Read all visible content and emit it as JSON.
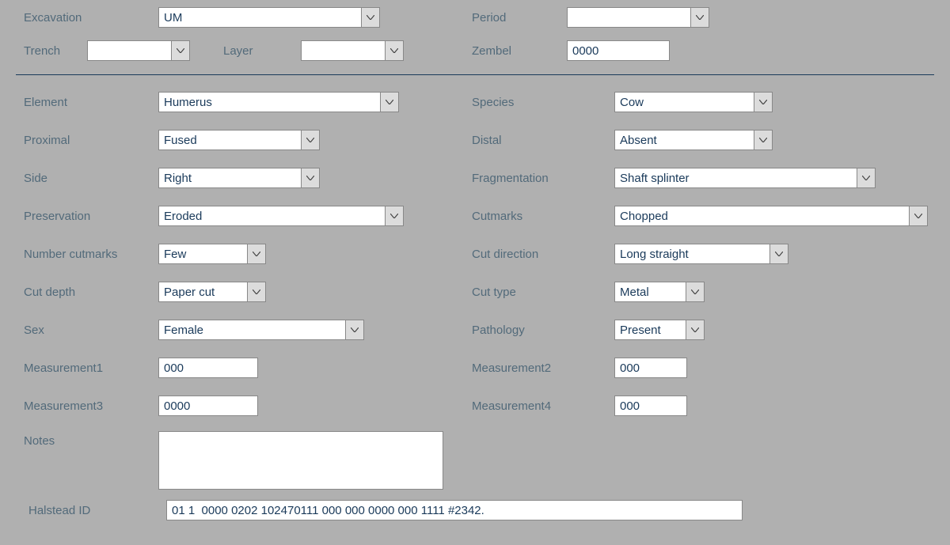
{
  "top": {
    "excavation": {
      "label": "Excavation",
      "value": "UM"
    },
    "period": {
      "label": "Period",
      "value": ""
    },
    "trench": {
      "label": "Trench",
      "value": ""
    },
    "layer": {
      "label": "Layer",
      "value": ""
    },
    "zembel": {
      "label": "Zembel",
      "value": "0000"
    }
  },
  "fields": {
    "element": {
      "label": "Element",
      "value": "Humerus"
    },
    "species": {
      "label": "Species",
      "value": "Cow"
    },
    "proximal": {
      "label": "Proximal",
      "value": "Fused"
    },
    "distal": {
      "label": "Distal",
      "value": "Absent"
    },
    "side": {
      "label": "Side",
      "value": "Right"
    },
    "fragmentation": {
      "label": "Fragmentation",
      "value": "Shaft splinter"
    },
    "preservation": {
      "label": "Preservation",
      "value": "Eroded"
    },
    "cutmarks": {
      "label": "Cutmarks",
      "value": "Chopped"
    },
    "number_cutmarks": {
      "label": "Number cutmarks",
      "value": "Few"
    },
    "cut_direction": {
      "label": "Cut direction",
      "value": "Long straight"
    },
    "cut_depth": {
      "label": "Cut depth",
      "value": "Paper cut"
    },
    "cut_type": {
      "label": "Cut type",
      "value": "Metal"
    },
    "sex": {
      "label": "Sex",
      "value": "Female"
    },
    "pathology": {
      "label": "Pathology",
      "value": "Present"
    },
    "measurement1": {
      "label": "Measurement1",
      "value": "000"
    },
    "measurement2": {
      "label": "Measurement2",
      "value": "000"
    },
    "measurement3": {
      "label": "Measurement3",
      "value": "0000"
    },
    "measurement4": {
      "label": "Measurement4",
      "value": "000"
    },
    "notes": {
      "label": "Notes",
      "value": ""
    },
    "halstead_id": {
      "label": "Halstead ID",
      "value": "01 1  0000 0202 102470111 000 000 0000 000 1111 #2342."
    }
  }
}
